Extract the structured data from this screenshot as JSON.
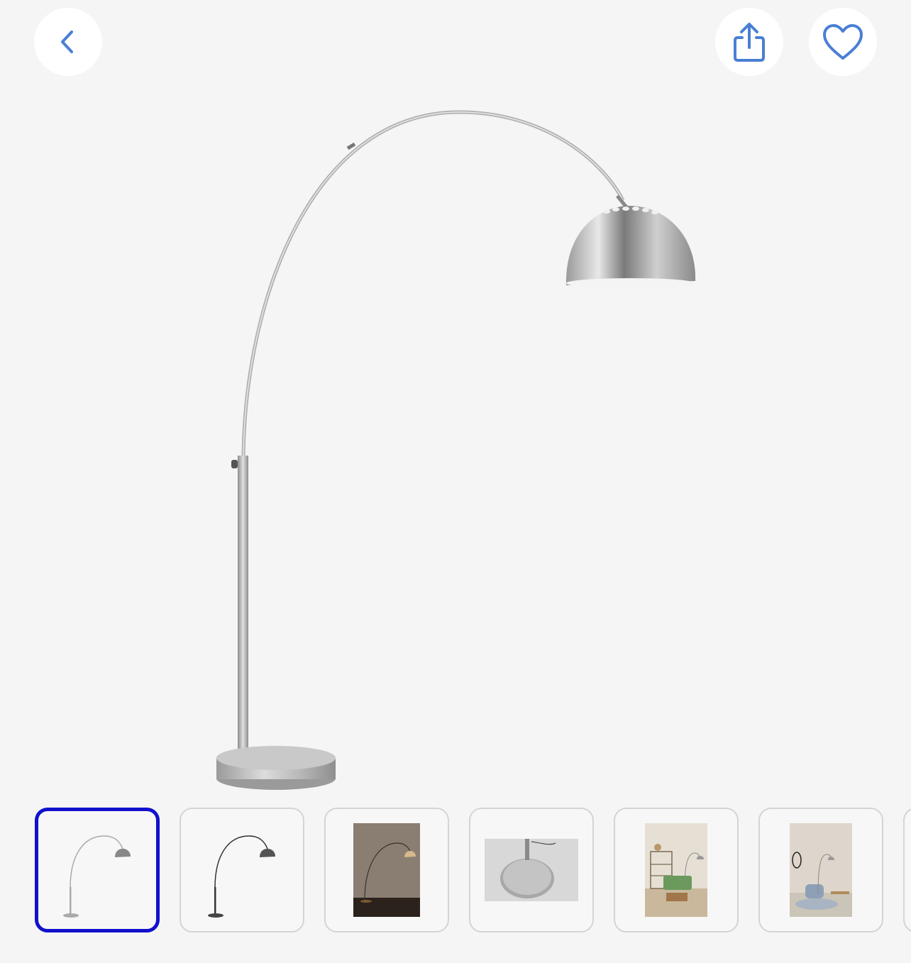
{
  "header": {
    "back_icon": "chevron-left-icon",
    "share_icon": "share-icon",
    "favorite_icon": "heart-icon"
  },
  "colors": {
    "accent": "#4a7fd4",
    "selected_border": "#1111cc",
    "background": "#f5f5f5"
  },
  "gallery": {
    "selected_index": 0,
    "thumbnails": [
      {
        "name": "thumbnail-lamp-silver"
      },
      {
        "name": "thumbnail-lamp-black"
      },
      {
        "name": "thumbnail-lamp-dark-room"
      },
      {
        "name": "thumbnail-lamp-base-detail"
      },
      {
        "name": "thumbnail-lamp-living-room-green-sofa"
      },
      {
        "name": "thumbnail-lamp-living-room-grey-chair"
      }
    ]
  }
}
